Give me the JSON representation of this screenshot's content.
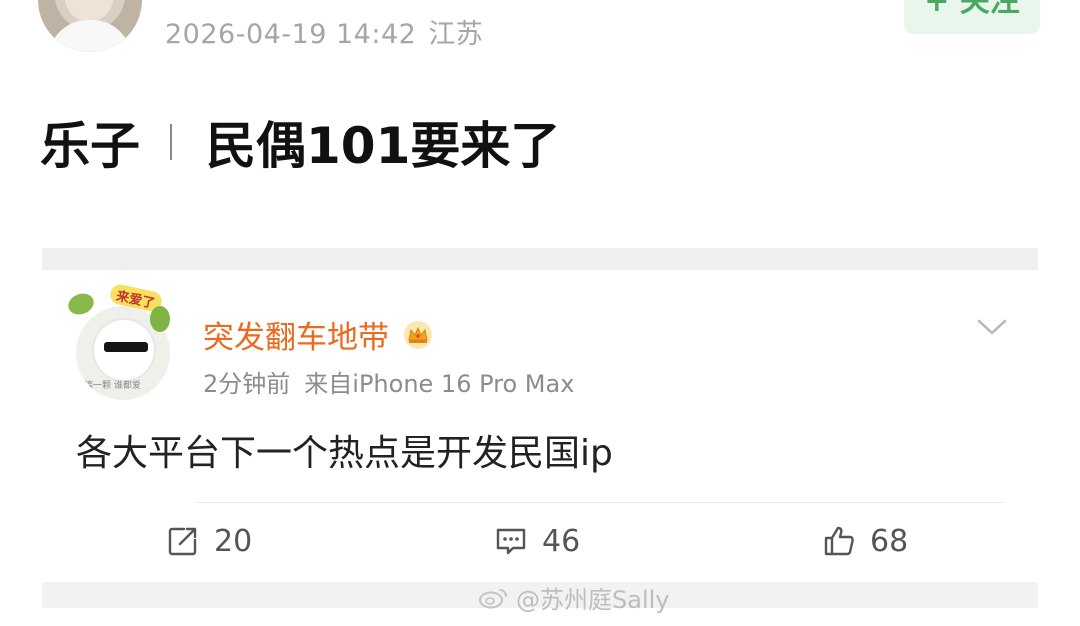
{
  "header": {
    "timestamp": "2026-04-19 14:42",
    "location": "江苏",
    "follow_label": "+ 关注"
  },
  "post": {
    "title_left": "乐子",
    "title_right": "民偶101要来了"
  },
  "comment": {
    "avatar_sticker": "来爱了",
    "avatar_caption": "搞一颗 谁都爱",
    "username": "突发翻车地带",
    "time": "2分钟前",
    "source": "来自iPhone 16 Pro Max",
    "text": "各大平台下一个热点是开发民国ip"
  },
  "actions": {
    "repost_count": "20",
    "comment_count": "46",
    "like_count": "68"
  },
  "watermark": {
    "text": "@苏州庭Sally"
  },
  "colors": {
    "username": "#ea6b1d",
    "follow_green": "#4aa864",
    "meta_gray": "#a6a6a6"
  }
}
